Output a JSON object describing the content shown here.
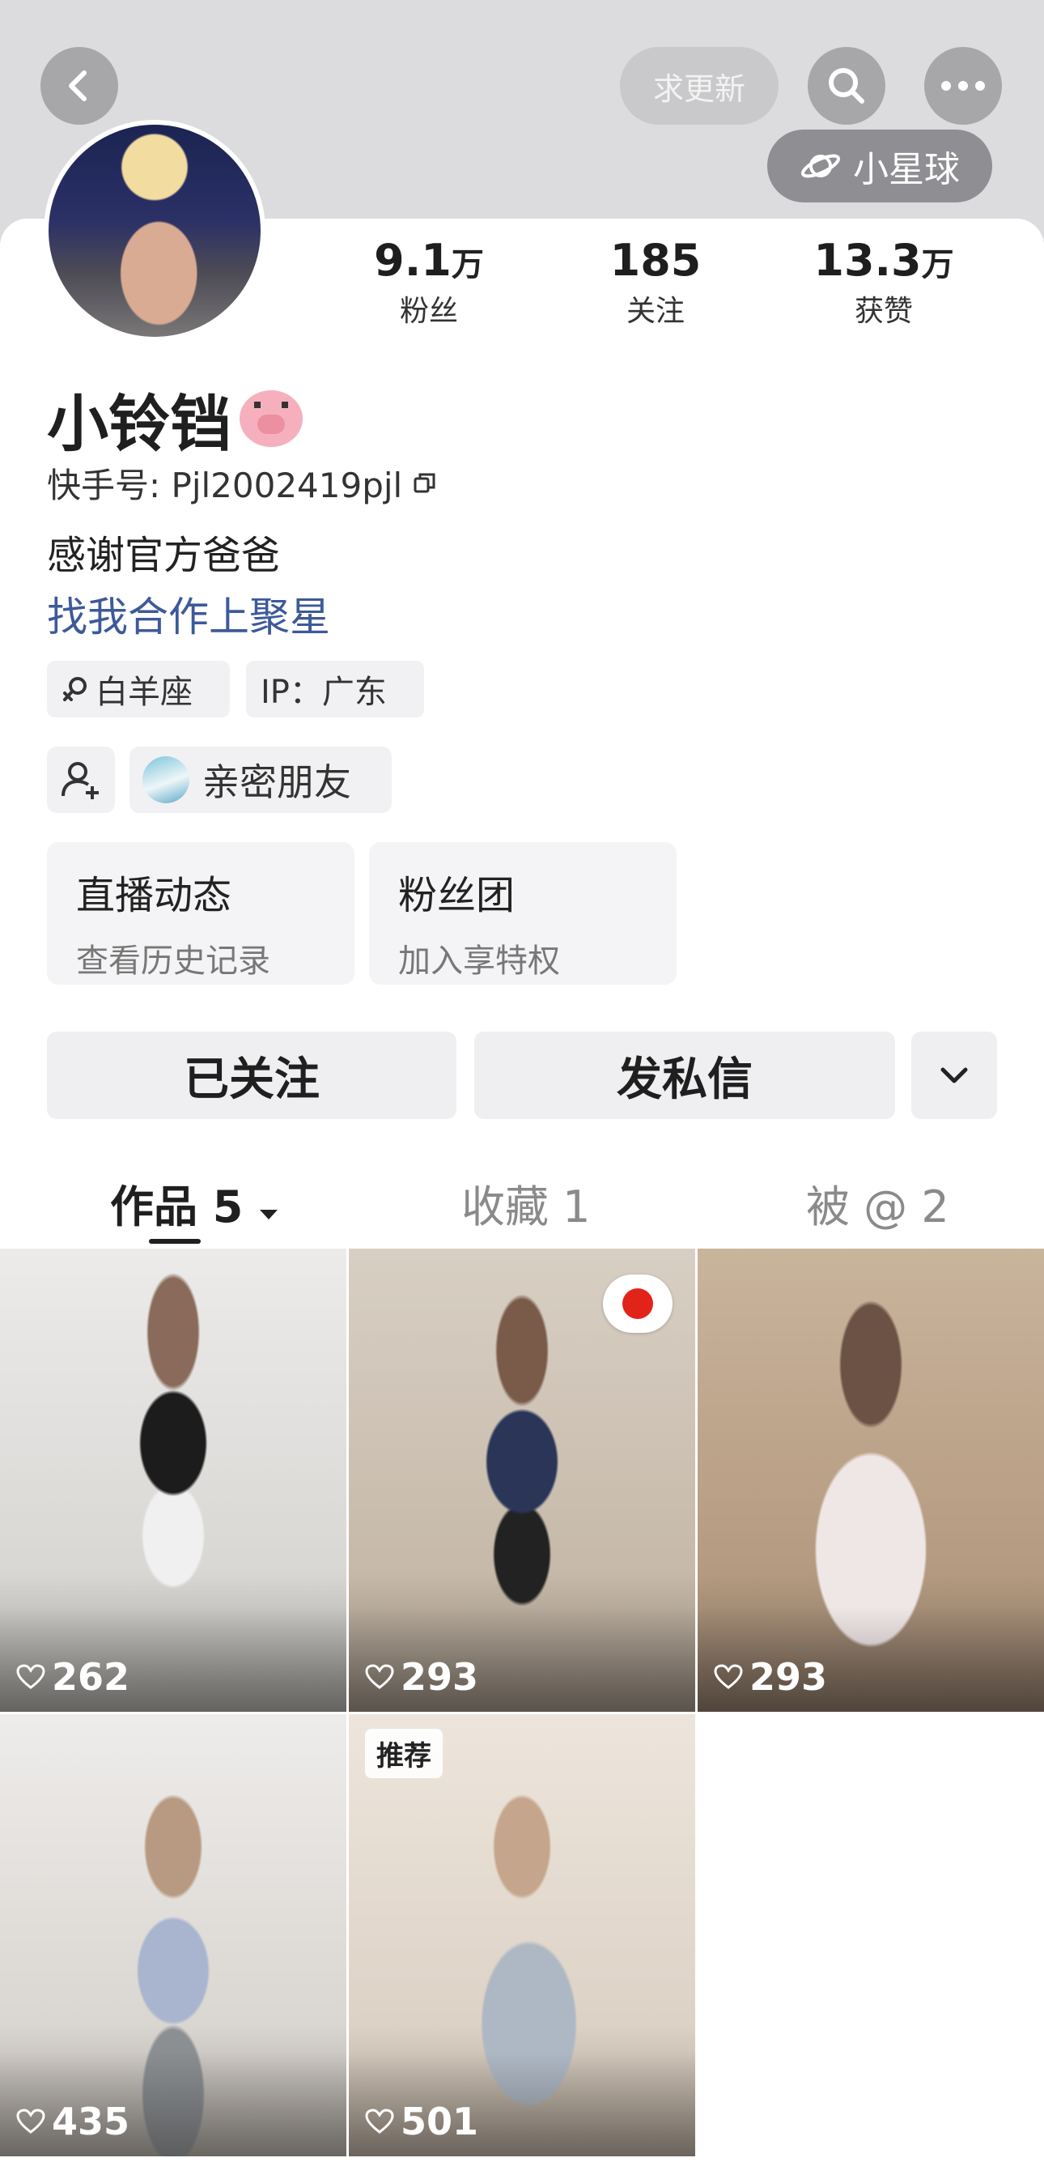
{
  "header": {
    "update_label": "求更新",
    "planet_label": "小星球",
    "icons": [
      "back-icon",
      "search-icon",
      "more-icon",
      "planet-icon"
    ]
  },
  "stats": [
    {
      "value": "9.1",
      "unit": "万",
      "label": "粉丝"
    },
    {
      "value": "185",
      "unit": "",
      "label": "关注"
    },
    {
      "value": "13.3",
      "unit": "万",
      "label": "获赞"
    }
  ],
  "profile": {
    "name": "小铃铛",
    "kuaishou_id": "快手号: Pjl2002419pjl",
    "bio": "感谢官方爸爸",
    "link": "找我合作上聚星",
    "tags": [
      "白羊座",
      "IP：广东"
    ],
    "friend_tag": "亲密朋友"
  },
  "feature_boxes": [
    {
      "title": "直播动态",
      "subtitle": "查看历史记录"
    },
    {
      "title": "粉丝团",
      "subtitle": "加入享特权"
    }
  ],
  "actions": {
    "follow": "已关注",
    "message": "发私信"
  },
  "tabs": [
    {
      "label": "作品 5"
    },
    {
      "label": "收藏 1"
    },
    {
      "label": "被 @ 2"
    }
  ],
  "videos": [
    {
      "likes": "262",
      "badge": ""
    },
    {
      "likes": "293",
      "badge": ""
    },
    {
      "likes": "293",
      "badge": ""
    },
    {
      "likes": "435",
      "badge": ""
    },
    {
      "likes": "501",
      "badge": "推荐"
    }
  ],
  "colors": {
    "header_bg": "#dcdcde",
    "link": "#3d5a99",
    "chip_bg": "#f1f1f3"
  }
}
